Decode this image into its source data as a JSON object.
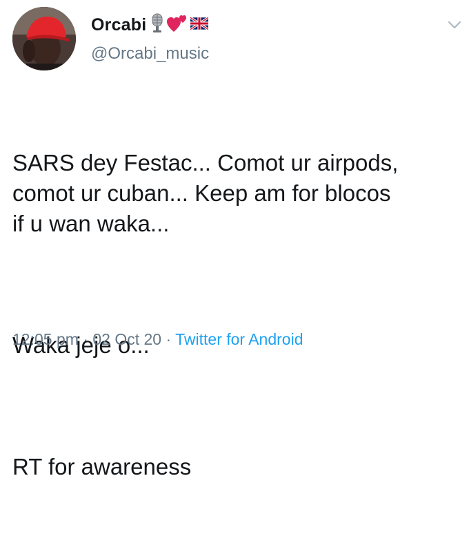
{
  "user": {
    "display_name": "Orcabi",
    "handle": "@Orcabi_music",
    "name_emojis": [
      "microphone-emoji",
      "hearts-emoji",
      "uk-flag-emoji"
    ]
  },
  "tweet": {
    "paragraphs": [
      "SARS dey Festac... Comot ur airpods,\ncomot ur cuban... Keep am for blocos\nif u wan waka...",
      "Waka jeje o...",
      "RT for awareness"
    ]
  },
  "meta": {
    "time": "12:05 pm",
    "sep1": " · ",
    "date": "02 Oct 20",
    "sep2": " · ",
    "source": "Twitter for Android"
  },
  "colors": {
    "text": "#14171a",
    "secondary": "#657786",
    "link": "#1da1f2",
    "heart": "#e0245e"
  },
  "icons": {
    "menu": "chevron-down-icon"
  }
}
